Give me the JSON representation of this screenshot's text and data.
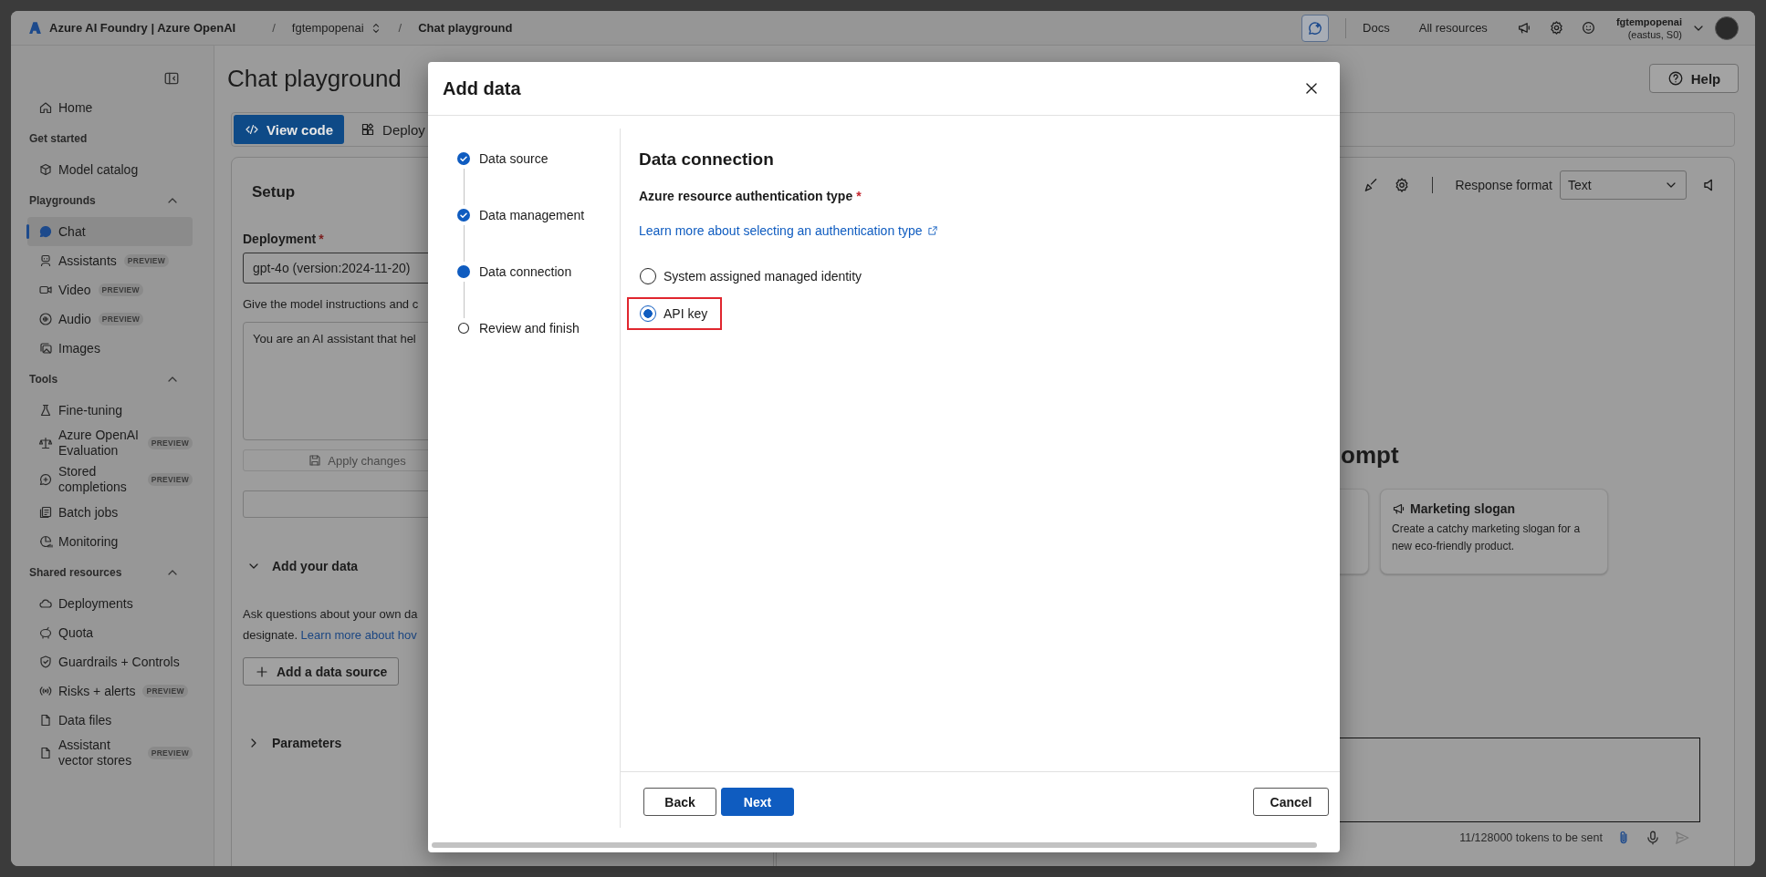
{
  "top_bar": {
    "product": "Azure AI Foundry | Azure OpenAI",
    "breadcrumbs": [
      {
        "separator": "/",
        "label": "fgtempopenai",
        "kind": "switcher"
      },
      {
        "separator": "/",
        "label": "Chat playground",
        "kind": "current"
      }
    ],
    "links": [
      "Docs",
      "All resources"
    ],
    "account": {
      "name": "fgtempopenai",
      "detail": "(eastus, S0)"
    }
  },
  "sidebar": {
    "items": [
      {
        "kind": "link",
        "label": "Home",
        "selected": false
      },
      {
        "kind": "section",
        "label": "Get started",
        "children": [
          {
            "label": "Model catalog",
            "selected": false
          }
        ]
      },
      {
        "kind": "section",
        "label": "Playgrounds",
        "expanded": true,
        "children": [
          {
            "label": "Chat",
            "selected": true
          },
          {
            "label": "Assistants",
            "badge": "PREVIEW",
            "selected": false
          },
          {
            "label": "Video",
            "badge": "PREVIEW",
            "selected": false
          },
          {
            "label": "Audio",
            "badge": "PREVIEW",
            "selected": false
          },
          {
            "label": "Images",
            "selected": false
          }
        ]
      },
      {
        "kind": "section",
        "label": "Tools",
        "expanded": true,
        "children": [
          {
            "label": "Fine-tuning",
            "selected": false
          },
          {
            "label": "Azure OpenAI Evaluation",
            "badge": "PREVIEW",
            "selected": false
          },
          {
            "label": "Stored completions",
            "badge": "PREVIEW",
            "selected": false
          },
          {
            "label": "Batch jobs",
            "selected": false
          },
          {
            "label": "Monitoring",
            "selected": false
          }
        ]
      },
      {
        "kind": "section",
        "label": "Shared resources",
        "expanded": true,
        "children": [
          {
            "label": "Deployments",
            "selected": false
          },
          {
            "label": "Quota",
            "selected": false
          },
          {
            "label": "Guardrails + Controls",
            "selected": false
          },
          {
            "label": "Risks + alerts",
            "badge": "PREVIEW",
            "selected": false
          },
          {
            "label": "Data files",
            "selected": false
          },
          {
            "label": "Assistant vector stores",
            "badge": "PREVIEW",
            "selected": false
          }
        ]
      }
    ]
  },
  "page": {
    "title": "Chat playground",
    "help_button": "Help",
    "toolbar": [
      {
        "label": "View code",
        "primary": true
      },
      {
        "label": "Deploy",
        "primary": false
      }
    ]
  },
  "setup": {
    "title": "Setup",
    "deployment": {
      "label": "Deployment",
      "required_mark": "*",
      "value": "gpt-4o (version:2024-11-20)"
    },
    "instructions_label": "Give the model instructions and c",
    "system_message": "You are an AI assistant that hel",
    "apply_button": {
      "label": "Apply changes",
      "disabled": true
    },
    "add_your_data": {
      "title": "Add your data",
      "expanded": true,
      "text_lines": [
        "Ask questions about your own da",
        "designate."
      ],
      "link": "Learn more about hov",
      "button": "Add a data source"
    },
    "parameters": {
      "title": "Parameters",
      "expanded": false
    }
  },
  "chat": {
    "response_format": {
      "label": "Response format",
      "value": "Text"
    },
    "heading": "ompt",
    "cards": [
      {
        "kind": "partial"
      },
      {
        "kind": "full",
        "title": "Marketing slogan",
        "text": "Create a catchy marketing slogan for a new eco-friendly product."
      }
    ],
    "token_count": "11/128000 tokens to be sent"
  },
  "dialog": {
    "title": "Add data",
    "steps": [
      {
        "label": "Data source",
        "completed": true,
        "selected": false
      },
      {
        "label": "Data management",
        "completed": true,
        "selected": false
      },
      {
        "label": "Data connection",
        "completed": false,
        "selected": true
      },
      {
        "label": "Review and finish",
        "completed": false,
        "selected": false
      }
    ],
    "heading": "Data connection",
    "field": {
      "label": "Azure resource authentication type",
      "required_mark": "*"
    },
    "link": "Learn more about selecting an authentication type",
    "options": [
      {
        "label": "System assigned managed identity",
        "selected": false,
        "highlighted": false
      },
      {
        "label": "API key",
        "selected": true,
        "highlighted": true
      }
    ],
    "buttons": {
      "back": "Back",
      "next": "Next",
      "cancel": "Cancel"
    }
  }
}
